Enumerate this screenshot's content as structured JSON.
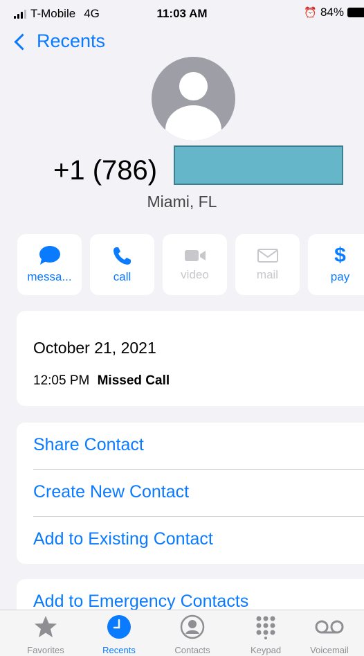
{
  "status": {
    "carrier": "T-Mobile",
    "network": "4G",
    "time": "11:03 AM",
    "battery": "84%"
  },
  "nav": {
    "back_label": "Recents"
  },
  "contact": {
    "number": "+1 (786)",
    "location": "Miami, FL"
  },
  "actions": [
    {
      "label": "messa...",
      "icon": "message-icon",
      "enabled": true
    },
    {
      "label": "call",
      "icon": "phone-icon",
      "enabled": true
    },
    {
      "label": "video",
      "icon": "video-icon",
      "enabled": false
    },
    {
      "label": "mail",
      "icon": "mail-icon",
      "enabled": false
    },
    {
      "label": "pay",
      "icon": "dollar-icon",
      "enabled": true
    }
  ],
  "history": {
    "date": "October 21, 2021",
    "time": "12:05 PM",
    "type": "Missed Call"
  },
  "options": [
    "Share Contact",
    "Create New Contact",
    "Add to Existing Contact",
    "Add to Emergency Contacts"
  ],
  "tabs": [
    {
      "label": "Favorites",
      "icon": "star-icon",
      "active": false
    },
    {
      "label": "Recents",
      "icon": "clock-icon",
      "active": true
    },
    {
      "label": "Contacts",
      "icon": "person-circle-icon",
      "active": false
    },
    {
      "label": "Keypad",
      "icon": "keypad-icon",
      "active": false
    },
    {
      "label": "Voicemail",
      "icon": "voicemail-icon",
      "active": false
    }
  ],
  "colors": {
    "accent": "#0a7aff",
    "background": "#f2f2f7",
    "redaction": "#65b6c9"
  }
}
